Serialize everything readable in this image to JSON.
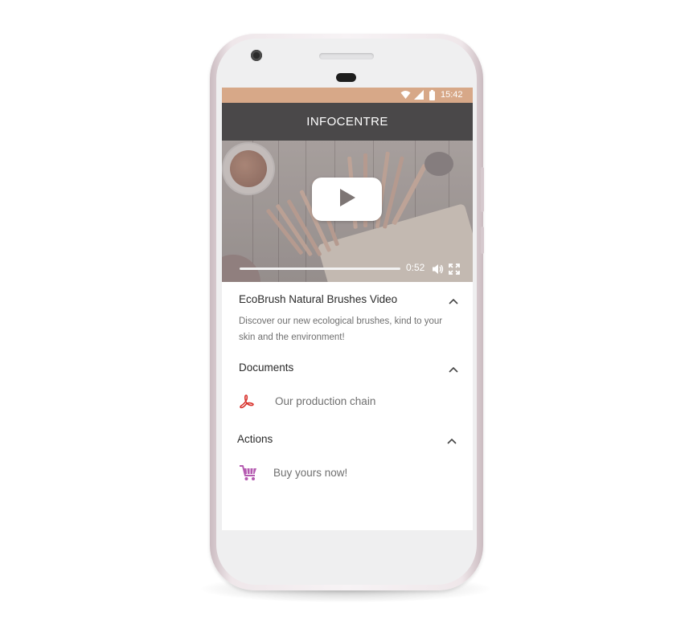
{
  "status_bar": {
    "time": "15:42"
  },
  "app_bar": {
    "title": "INFOCENTRE"
  },
  "video": {
    "elapsed": "0:52",
    "progress_fraction": 0.0
  },
  "sections": {
    "video_info": {
      "title": "EcoBrush Natural Brushes Video",
      "description": "Discover our new ecological brushes, kind to your skin and the environment!"
    },
    "documents": {
      "title": "Documents",
      "items": [
        {
          "label": "Our production chain",
          "icon": "pdf-icon"
        }
      ]
    },
    "actions": {
      "title": "Actions",
      "items": [
        {
          "label": "Buy yours now!",
          "icon": "cart-icon"
        }
      ]
    }
  },
  "colors": {
    "status_bar": "#d7a888",
    "app_bar": "#4a4849",
    "pdf_icon": "#d8322c",
    "cart_icon": "#b45ab0"
  }
}
